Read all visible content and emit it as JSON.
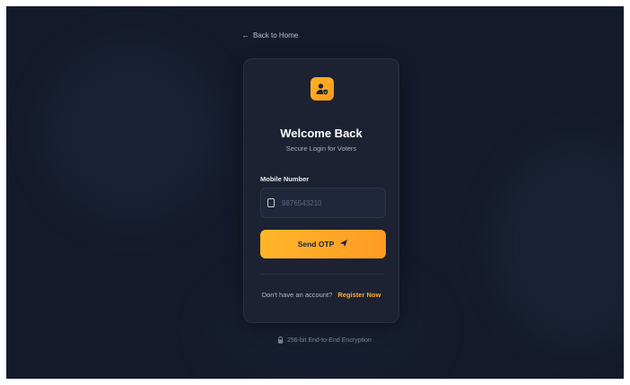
{
  "header": {
    "back_label": "Back to Home"
  },
  "login": {
    "title": "Welcome Back",
    "subtitle": "Secure Login for Voters",
    "field_label": "Mobile Number",
    "input_placeholder": "9876543210",
    "send_button_label": "Send OTP",
    "register_prompt": "Don't have an account?",
    "register_link": "Register Now"
  },
  "footer": {
    "encryption_text": "256-bit End-to-End Encryption"
  },
  "icons": {
    "back": "arrow-left-icon",
    "logo": "user-shield-icon",
    "phone": "phone-icon",
    "send": "send-arrow-icon",
    "lock": "lock-icon"
  },
  "colors": {
    "background": "#141a2b",
    "card": "#1c2232",
    "accent": "#ffb224",
    "accent_text": "#17223a"
  }
}
